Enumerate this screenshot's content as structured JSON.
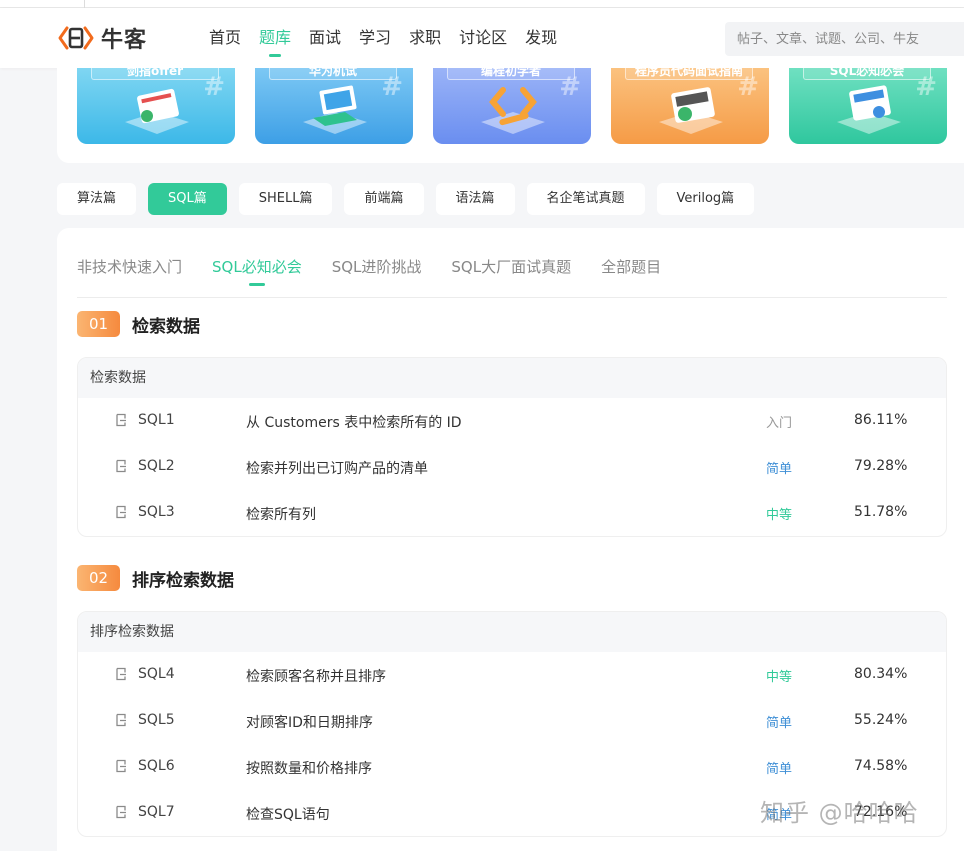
{
  "brand": {
    "name": "牛客"
  },
  "nav": {
    "items": [
      {
        "label": "首页",
        "active": false
      },
      {
        "label": "题库",
        "active": true
      },
      {
        "label": "面试",
        "active": false
      },
      {
        "label": "学习",
        "active": false
      },
      {
        "label": "求职",
        "active": false
      },
      {
        "label": "讨论区",
        "active": false
      },
      {
        "label": "发现",
        "active": false
      }
    ]
  },
  "search": {
    "placeholder": "帖子、文章、试题、公司、牛友"
  },
  "banners": [
    {
      "title": "剑指offer",
      "color_top": "#7fd6f2",
      "color_bottom": "#3cb8e8",
      "art": "book-icon"
    },
    {
      "title": "华为机试",
      "color_top": "#7cc8f4",
      "color_bottom": "#3d9fe6",
      "art": "laptop-icon"
    },
    {
      "title": "编程初学者",
      "color_top": "#9ab3f7",
      "color_bottom": "#6a8ef0",
      "art": "code-icon"
    },
    {
      "title": "程序员代码面试指南",
      "color_top": "#fbc27f",
      "color_bottom": "#f59b46",
      "art": "book-icon"
    },
    {
      "title": "SQL必知必会",
      "color_top": "#6fe0c1",
      "color_bottom": "#2fc79e",
      "art": "book-icon"
    }
  ],
  "categories": [
    {
      "label": "算法篇",
      "active": false
    },
    {
      "label": "SQL篇",
      "active": true
    },
    {
      "label": "SHELL篇",
      "active": false
    },
    {
      "label": "前端篇",
      "active": false
    },
    {
      "label": "语法篇",
      "active": false
    },
    {
      "label": "名企笔试真题",
      "active": false
    },
    {
      "label": "Verilog篇",
      "active": false
    }
  ],
  "subtabs": [
    {
      "label": "非技术快速入门",
      "active": false
    },
    {
      "label": "SQL必知必会",
      "active": true
    },
    {
      "label": "SQL进阶挑战",
      "active": false
    },
    {
      "label": "SQL大厂面试真题",
      "active": false
    },
    {
      "label": "全部题目",
      "active": false
    }
  ],
  "sections": [
    {
      "num": "01",
      "title": "检索数据",
      "group": "检索数据",
      "questions": [
        {
          "id": "SQL1",
          "title": "从 Customers 表中检索所有的 ID",
          "level": "入门",
          "level_class": "lvl-intro",
          "rate": "86.11%"
        },
        {
          "id": "SQL2",
          "title": "检索并列出已订购产品的清单",
          "level": "简单",
          "level_class": "lvl-easy",
          "rate": "79.28%"
        },
        {
          "id": "SQL3",
          "title": "检索所有列",
          "level": "中等",
          "level_class": "lvl-mid",
          "rate": "51.78%"
        }
      ]
    },
    {
      "num": "02",
      "title": "排序检索数据",
      "group": "排序检索数据",
      "questions": [
        {
          "id": "SQL4",
          "title": "检索顾客名称并且排序",
          "level": "中等",
          "level_class": "lvl-mid",
          "rate": "80.34%"
        },
        {
          "id": "SQL5",
          "title": "对顾客ID和日期排序",
          "level": "简单",
          "level_class": "lvl-easy",
          "rate": "55.24%"
        },
        {
          "id": "SQL6",
          "title": "按照数量和价格排序",
          "level": "简单",
          "level_class": "lvl-easy",
          "rate": "74.58%"
        },
        {
          "id": "SQL7",
          "title": "检查SQL语句",
          "level": "简单",
          "level_class": "lvl-easy",
          "rate": "72.16%"
        }
      ]
    }
  ],
  "watermark": "知乎 @哈哈哈"
}
